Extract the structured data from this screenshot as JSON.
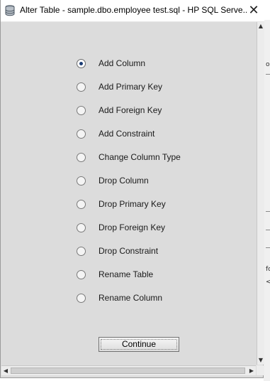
{
  "window": {
    "title": "Alter Table - sample.dbo.employee test.sql - HP SQL Serve...",
    "close_glyph": "✕"
  },
  "options": [
    {
      "label": "Add Column",
      "checked": true
    },
    {
      "label": "Add Primary Key",
      "checked": false
    },
    {
      "label": "Add Foreign Key",
      "checked": false
    },
    {
      "label": "Add Constraint",
      "checked": false
    },
    {
      "label": "Change Column Type",
      "checked": false
    },
    {
      "label": "Drop Column",
      "checked": false
    },
    {
      "label": "Drop Primary Key",
      "checked": false
    },
    {
      "label": "Drop Foreign Key",
      "checked": false
    },
    {
      "label": "Drop Constraint",
      "checked": false
    },
    {
      "label": "Rename Table",
      "checked": false
    },
    {
      "label": "Rename Column",
      "checked": false
    }
  ],
  "continue_button": {
    "label": "Continue"
  },
  "scrollbars": {
    "up_arrow": "▲",
    "down_arrow": "▼",
    "left_arrow": "◀",
    "right_arrow": "▶"
  },
  "background": {
    "fragment_top": "o",
    "fragment_mid": "fc",
    "fragment_bottom": "<"
  },
  "colors": {
    "dialog_bg": "#dcdcdc",
    "radio_selected_dot": "#1c3d75"
  },
  "icons": {
    "app": "database-icon",
    "close": "close-icon"
  }
}
